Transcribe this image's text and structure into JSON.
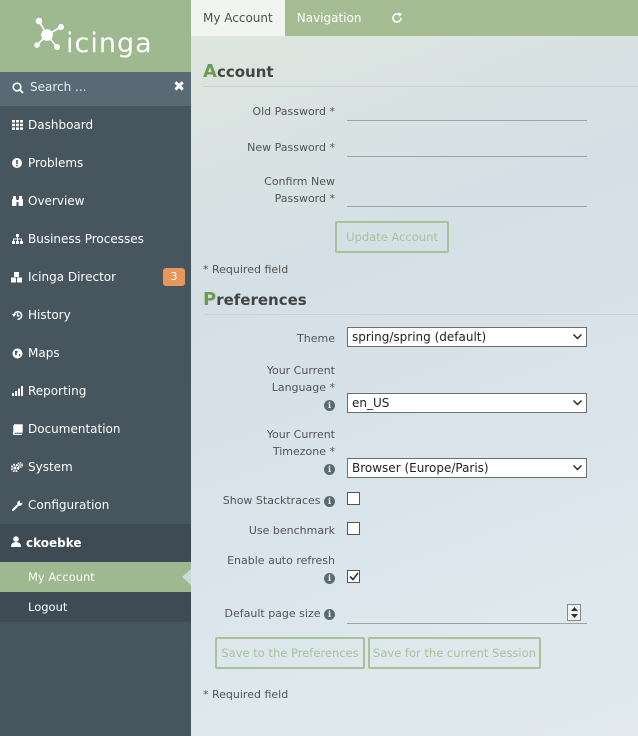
{
  "brand": {
    "logo_text": "icinga"
  },
  "search": {
    "placeholder": "Search ..."
  },
  "sidebar": {
    "items": [
      {
        "label": "Dashboard",
        "icon": "dashboard-icon"
      },
      {
        "label": "Problems",
        "icon": "alert-icon"
      },
      {
        "label": "Overview",
        "icon": "binoculars-icon"
      },
      {
        "label": "Business Processes",
        "icon": "sitemap-icon"
      },
      {
        "label": "Icinga Director",
        "icon": "cubes-icon",
        "badge": "3"
      },
      {
        "label": "History",
        "icon": "history-icon"
      },
      {
        "label": "Maps",
        "icon": "globe-icon"
      },
      {
        "label": "Reporting",
        "icon": "chart-icon"
      },
      {
        "label": "Documentation",
        "icon": "book-icon"
      },
      {
        "label": "System",
        "icon": "cogs-icon"
      },
      {
        "label": "Configuration",
        "icon": "wrench-icon"
      }
    ],
    "user": {
      "name": "ckoebke",
      "sub_items": [
        "My Account",
        "Logout"
      ]
    }
  },
  "tabs": {
    "my_account": "My Account",
    "navigation": "Navigation"
  },
  "account": {
    "heading_first": "A",
    "heading_rest": "ccount",
    "old_password_label": "Old Password *",
    "new_password_label": "New Password *",
    "confirm_label_1": "Confirm New",
    "confirm_label_2": "Password *",
    "update_button": "Update Account",
    "required_note": "* Required field"
  },
  "preferences": {
    "heading_first": "P",
    "heading_rest": "references",
    "theme_label": "Theme",
    "theme_value": "spring/spring (default)",
    "language_label_1": "Your Current",
    "language_label_2": "Language *",
    "language_value": "en_US",
    "timezone_label_1": "Your Current",
    "timezone_label_2": "Timezone *",
    "timezone_value": "Browser (Europe/Paris)",
    "stacktraces_label": "Show Stacktraces",
    "stacktraces_checked": false,
    "benchmark_label": "Use benchmark",
    "benchmark_checked": false,
    "auto_refresh_label": "Enable auto refresh",
    "auto_refresh_checked": true,
    "page_size_label": "Default page size",
    "save_prefs_button": "Save to the Preferences",
    "save_session_button": "Save for the current Session",
    "required_note": "* Required field"
  },
  "colors": {
    "accent": "#9eb98f",
    "sidebar": "#47555f",
    "badge": "#e8965a"
  }
}
